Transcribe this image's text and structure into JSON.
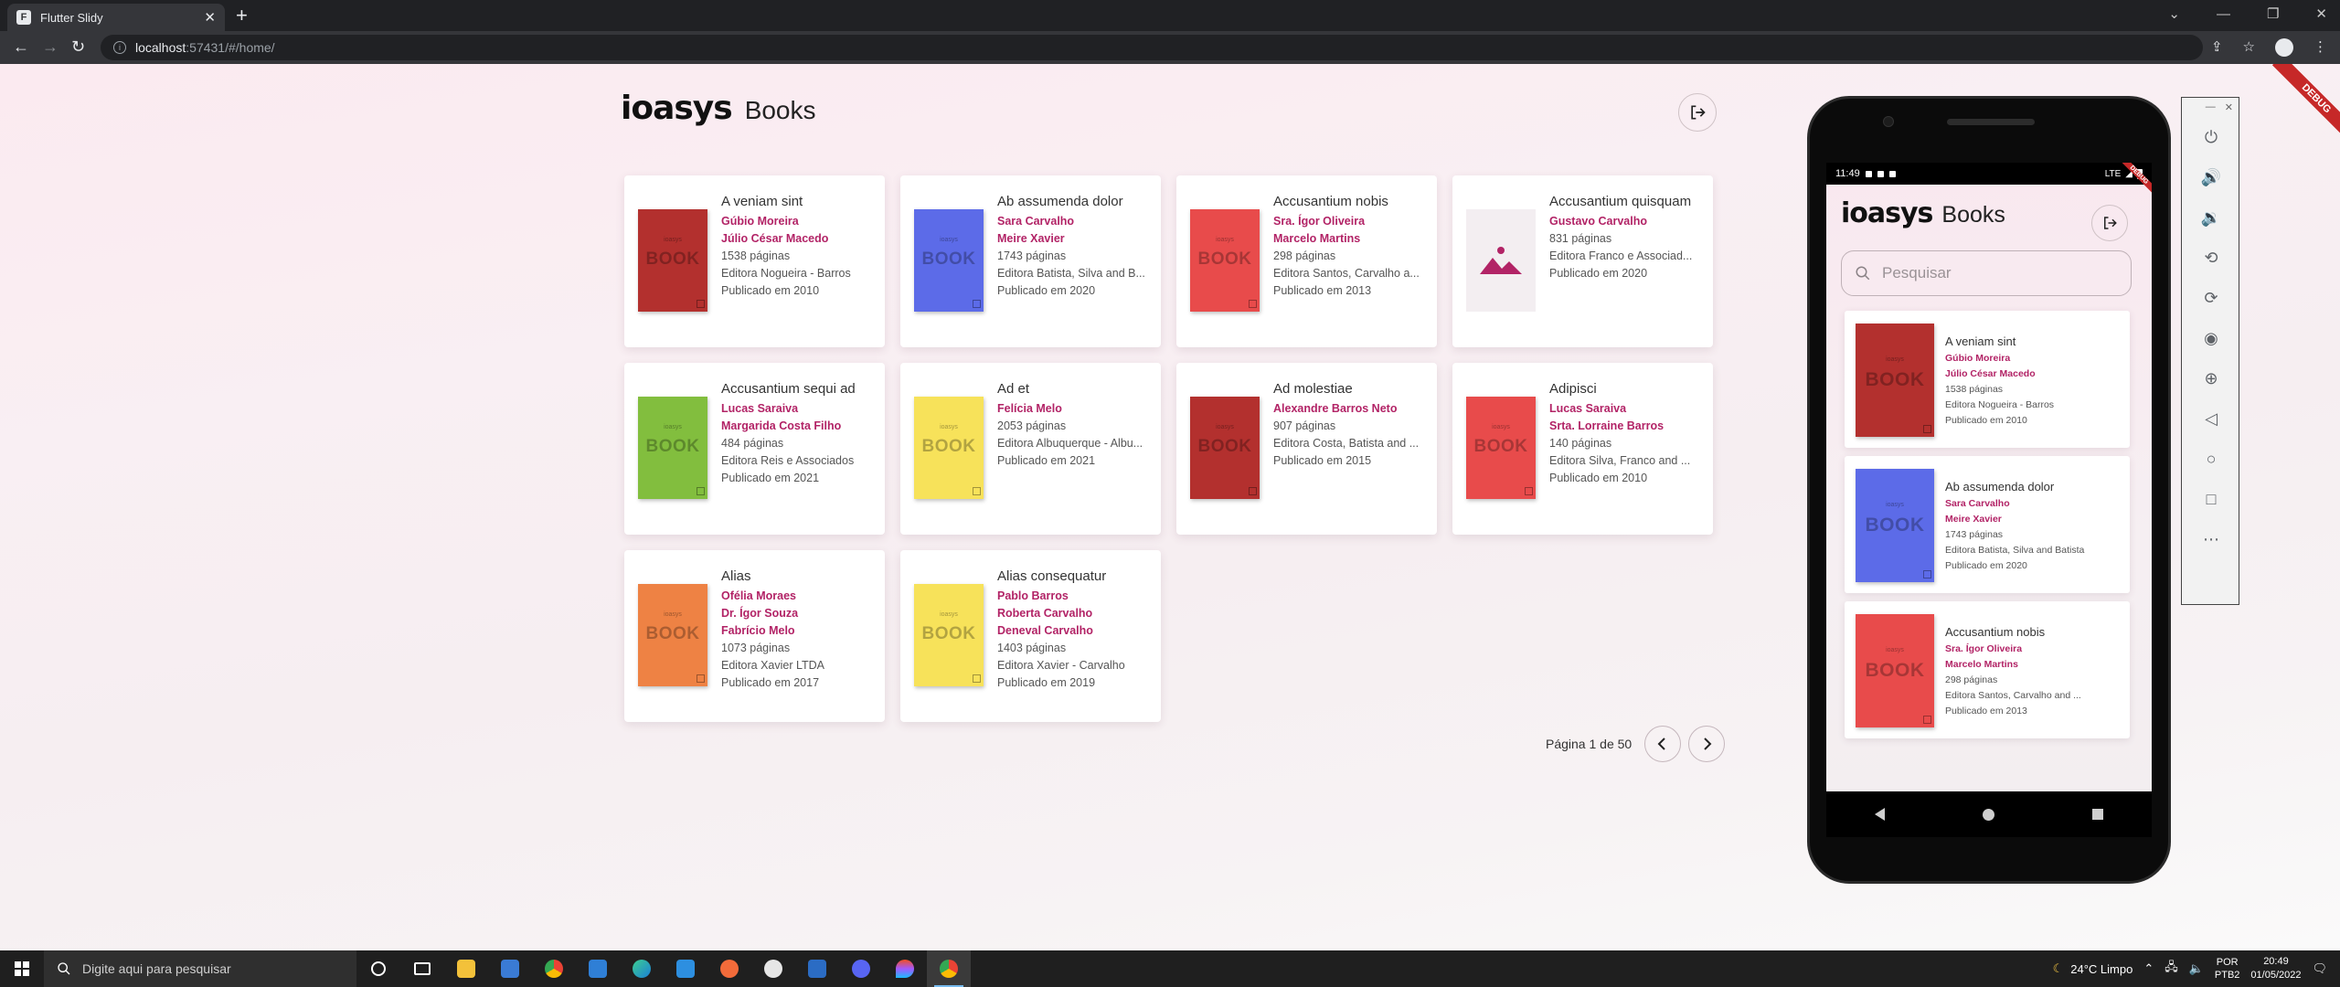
{
  "browser": {
    "tab_title": "Flutter Slidy",
    "url_host": "localhost",
    "url_rest": ":57431/#/home/"
  },
  "app": {
    "brand": "ioasys",
    "title": "Books",
    "author_color": "#b22366"
  },
  "books": [
    {
      "title": "A veniam sint",
      "authors": [
        "Gúbio Moreira",
        "Júlio César Macedo"
      ],
      "pages": "1538 páginas",
      "publisher": "Editora Nogueira - Barros",
      "published": "Publicado em 2010",
      "cover_color": "#b3302e"
    },
    {
      "title": "Ab assumenda dolor",
      "authors": [
        "Sara Carvalho",
        "Meire Xavier"
      ],
      "pages": "1743 páginas",
      "publisher": "Editora Batista, Silva and B...",
      "published": "Publicado em 2020",
      "cover_color": "#5c6be8"
    },
    {
      "title": "Accusantium nobis",
      "authors": [
        "Sra. Ígor Oliveira",
        "Marcelo Martins"
      ],
      "pages": "298 páginas",
      "publisher": "Editora Santos, Carvalho a...",
      "published": "Publicado em 2013",
      "cover_color": "#e84b4b"
    },
    {
      "title": "Accusantium quisquam",
      "authors": [
        "Gustavo Carvalho"
      ],
      "pages": "831 páginas",
      "publisher": "Editora Franco e Associad...",
      "published": "Publicado em 2020",
      "cover_color": "placeholder"
    },
    {
      "title": "Accusantium sequi ad",
      "authors": [
        "Lucas Saraiva",
        "Margarida Costa Filho"
      ],
      "pages": "484 páginas",
      "publisher": "Editora Reis e Associados",
      "published": "Publicado em 2021",
      "cover_color": "#82be3e"
    },
    {
      "title": "Ad et",
      "authors": [
        "Felícia Melo"
      ],
      "pages": "2053 páginas",
      "publisher": "Editora Albuquerque - Albu...",
      "published": "Publicado em 2021",
      "cover_color": "#f7e25a"
    },
    {
      "title": "Ad molestiae",
      "authors": [
        "Alexandre Barros Neto"
      ],
      "pages": "907 páginas",
      "publisher": "Editora Costa, Batista and ...",
      "published": "Publicado em 2015",
      "cover_color": "#b3302e"
    },
    {
      "title": "Adipisci",
      "authors": [
        "Lucas Saraiva",
        "Srta. Lorraine Barros"
      ],
      "pages": "140 páginas",
      "publisher": "Editora Silva, Franco and ...",
      "published": "Publicado em 2010",
      "cover_color": "#e84b4b"
    },
    {
      "title": "Alias",
      "authors": [
        "Ofélia Moraes",
        "Dr. Ígor Souza",
        "Fabrício Melo"
      ],
      "pages": "1073 páginas",
      "publisher": "Editora Xavier LTDA",
      "published": "Publicado em 2017",
      "cover_color": "#ee8244"
    },
    {
      "title": "Alias consequatur",
      "authors": [
        "Pablo Barros",
        "Roberta Carvalho",
        "Deneval Carvalho"
      ],
      "pages": "1403 páginas",
      "publisher": "Editora Xavier - Carvalho",
      "published": "Publicado em 2019",
      "cover_color": "#f7e25a"
    }
  ],
  "cover": {
    "brand": "ioasys",
    "word": "BOOK"
  },
  "pagination": {
    "text": "Página 1 de 50"
  },
  "mobile": {
    "time": "11:49",
    "network": "LTE",
    "search_placeholder": "Pesquisar",
    "books": [
      {
        "title": "A veniam sint",
        "authors": [
          "Gúbio Moreira",
          "Júlio César Macedo"
        ],
        "pages": "1538 páginas",
        "publisher": "Editora Nogueira - Barros",
        "published": "Publicado em 2010",
        "cover_color": "#b3302e"
      },
      {
        "title": "Ab assumenda dolor",
        "authors": [
          "Sara Carvalho",
          "Meire Xavier"
        ],
        "pages": "1743 páginas",
        "publisher": "Editora Batista, Silva and Batista",
        "published": "Publicado em 2020",
        "cover_color": "#5c6be8"
      },
      {
        "title": "Accusantium nobis",
        "authors": [
          "Sra. Ígor Oliveira",
          "Marcelo Martins"
        ],
        "pages": "298 páginas",
        "publisher": "Editora Santos, Carvalho and ...",
        "published": "Publicado em 2013",
        "cover_color": "#e84b4b"
      }
    ]
  },
  "debug_banner": "DEBUG",
  "taskbar": {
    "search_placeholder": "Digite aqui para pesquisar",
    "weather": "24°C  Limpo",
    "lang_line1": "POR",
    "lang_line2": "PTB2",
    "time": "20:49",
    "date": "01/05/2022"
  }
}
